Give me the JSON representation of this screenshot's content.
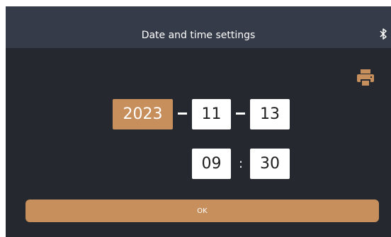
{
  "header": {
    "title": "Date and time settings",
    "bluetooth_icon": "bluetooth-icon"
  },
  "toolbar": {
    "printer_icon": "printer-icon"
  },
  "date": {
    "year": "2023",
    "month": "11",
    "day": "13",
    "selected_field": "year"
  },
  "time": {
    "hour": "09",
    "separator": ":",
    "minute": "30"
  },
  "actions": {
    "ok_label": "OK"
  },
  "colors": {
    "background": "#25292f",
    "titlebar": "#363b49",
    "accent": "#c68f5c",
    "field": "#ffffff"
  }
}
